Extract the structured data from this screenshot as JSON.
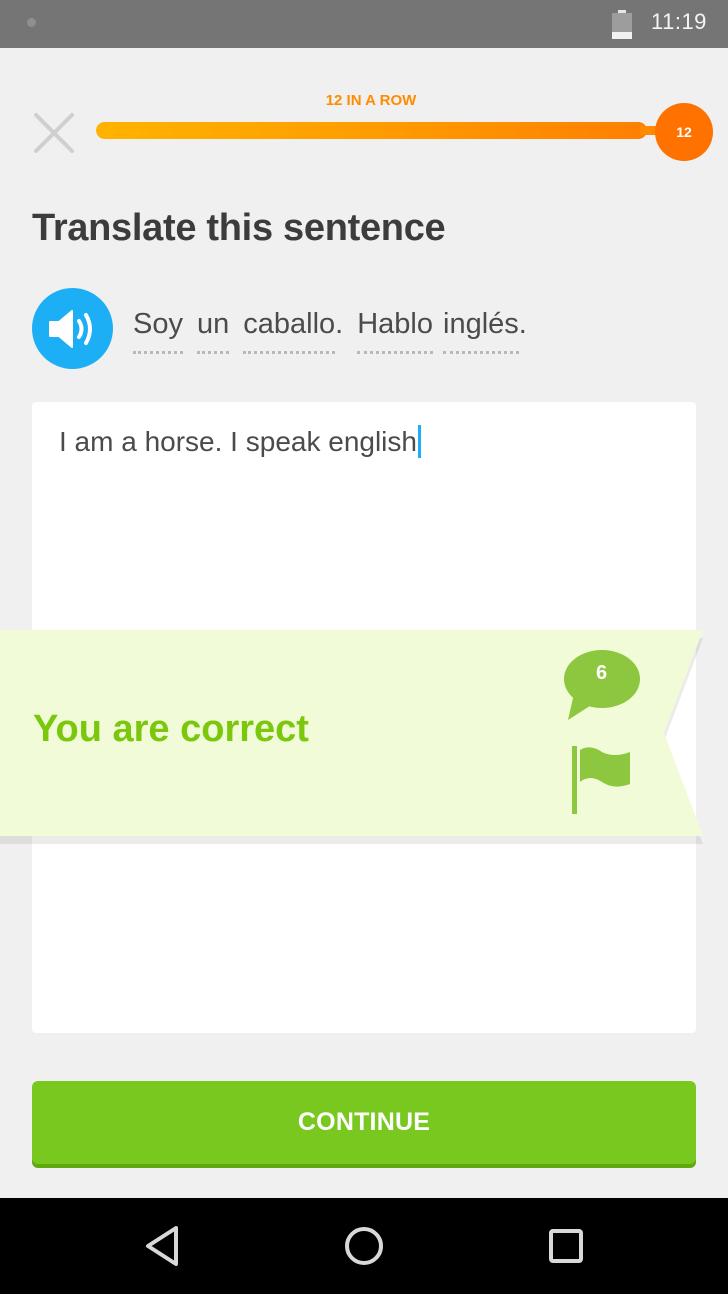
{
  "status_bar": {
    "time": "11:19"
  },
  "header": {
    "streak_label": "12 IN A ROW",
    "streak_count": "12",
    "progress_fraction": 1.0
  },
  "prompt": {
    "title": "Translate this sentence",
    "words": [
      "Soy",
      "un",
      "caballo",
      ".",
      "Hablo",
      "inglés",
      "."
    ]
  },
  "answer": {
    "value": "I am a horse. I speak english"
  },
  "feedback": {
    "message": "You are correct",
    "comment_count": "6"
  },
  "actions": {
    "continue_label": "CONTINUE"
  },
  "colors": {
    "brand_green": "#78c81f",
    "correct_text": "#7ac70c",
    "banner_bg": "#f1fbd8",
    "streak_orange": "#ff7200",
    "speaker_blue": "#1caff6"
  },
  "icons": [
    "close-icon",
    "speaker-icon",
    "comment-icon",
    "flag-icon",
    "back-icon",
    "home-icon",
    "recents-icon",
    "battery-icon"
  ]
}
